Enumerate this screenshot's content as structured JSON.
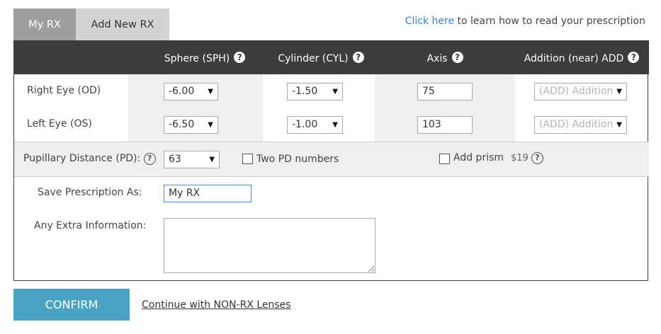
{
  "tabs": {
    "my_rx": "My RX",
    "add_new": "Add New RX"
  },
  "help": {
    "link_text": "Click here",
    "suffix": " to learn how to read your prescription"
  },
  "columns": {
    "sphere": "Sphere (SPH)",
    "cylinder": "Cylinder (CYL)",
    "axis": "Axis",
    "addition": "Addition (near) ADD"
  },
  "rows": {
    "right": {
      "label": "Right Eye (OD)",
      "sphere": "-6.00",
      "cylinder": "-1.50",
      "axis": "75",
      "addition_placeholder": "(ADD) Addition"
    },
    "left": {
      "label": "Left Eye (OS)",
      "sphere": "-6.50",
      "cylinder": "-1.00",
      "axis": "103",
      "addition_placeholder": "(ADD) Addition"
    }
  },
  "pd": {
    "label": "Pupillary Distance (PD):",
    "value": "63",
    "two_pd_label": "Two PD numbers",
    "prism_label": "Add prism",
    "prism_price": "$19"
  },
  "save": {
    "label": "Save Prescription As:",
    "value": "My RX",
    "extra_label": "Any Extra Information:",
    "extra_value": ""
  },
  "actions": {
    "confirm": "CONFIRM",
    "non_rx": "Continue with NON-RX Lenses"
  },
  "icons": {
    "help": "question-circle-icon",
    "dropdown": "triangle-down-icon",
    "resize": "resize-grip-icon"
  },
  "colors": {
    "header_bg": "#3c3c3c",
    "confirm_bg": "#4ba3c3",
    "link": "#2e86b8",
    "active_tab": "#d3d3d3",
    "inactive_tab": "#9e9e9e"
  }
}
